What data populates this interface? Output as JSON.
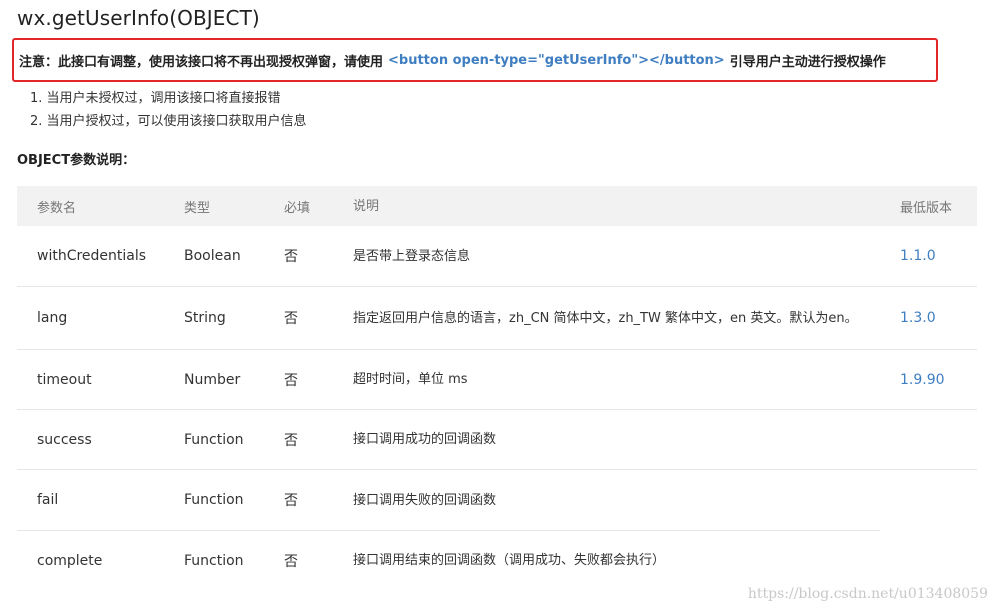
{
  "title": "wx.getUserInfo(OBJECT)",
  "notice": {
    "prefix": "注意：此接口有调整，使用该接口将不再出现授权弹窗，请使用",
    "code": "<button open-type=\"getUserInfo\"></button>",
    "suffix": "引导用户主动进行授权操作"
  },
  "steps": [
    "1. 当用户未授权过，调用该接口将直接报错",
    "2. 当用户授权过，可以使用该接口获取用户信息"
  ],
  "params_heading": "OBJECT参数说明：",
  "table": {
    "headers": [
      "参数名",
      "类型",
      "必填",
      "说明",
      "最低版本"
    ],
    "rows": [
      [
        "withCredentials",
        "Boolean",
        "否",
        "是否带上登录态信息",
        "1.1.0"
      ],
      [
        "lang",
        "String",
        "否",
        "指定返回用户信息的语言，zh_CN 简体中文，zh_TW 繁体中文，en 英文。默认为en。",
        "1.3.0"
      ],
      [
        "timeout",
        "Number",
        "否",
        "超时时间，单位 ms",
        "1.9.90"
      ],
      [
        "success",
        "Function",
        "否",
        "接口调用成功的回调函数",
        ""
      ],
      [
        "fail",
        "Function",
        "否",
        "接口调用失败的回调函数",
        ""
      ],
      [
        "complete",
        "Function",
        "否",
        "接口调用结束的回调函数（调用成功、失败都会执行）",
        ""
      ]
    ]
  },
  "watermark": "https://blog.csdn.net/u013408059",
  "colors": {
    "notice_border": "#e3262a",
    "code_text": "#3f7ec1",
    "header_bg": "#f2f2f2",
    "link": "#3f7ec1"
  }
}
